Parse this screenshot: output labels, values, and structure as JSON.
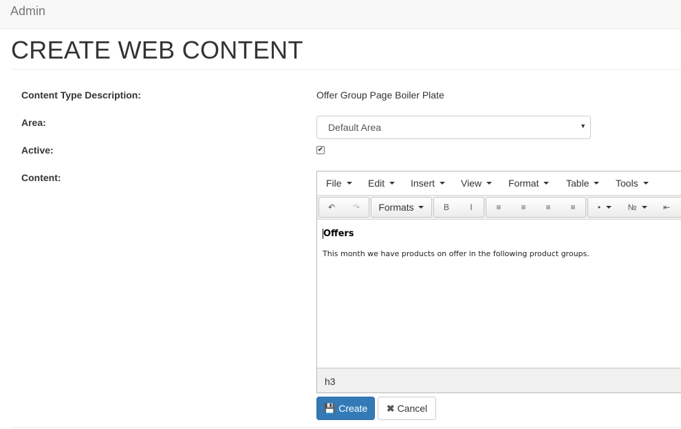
{
  "app": {
    "brand": "Admin"
  },
  "page": {
    "title": "CREATE WEB CONTENT"
  },
  "form": {
    "content_type_label": "Content Type Description:",
    "content_type_value": "Offer Group Page Boiler Plate",
    "area_label": "Area:",
    "area_selected": "Default Area",
    "active_label": "Active:",
    "active_checked": true,
    "content_label": "Content:"
  },
  "editor": {
    "menu": [
      "File",
      "Edit",
      "Insert",
      "View",
      "Format",
      "Table",
      "Tools"
    ],
    "formats_label": "Formats",
    "toolbar_icons": [
      "undo-icon",
      "redo-icon",
      "align-left-icon",
      "align-center-icon",
      "align-right-icon",
      "align-justify-icon",
      "bullet-list-icon",
      "numbered-list-icon",
      "outdent-icon"
    ],
    "document": {
      "heading": "Offers",
      "paragraph": "This month we have products on offer in the following product groups."
    },
    "statusbar_path": "h3"
  },
  "actions": {
    "create_label": "Create",
    "cancel_label": "Cancel"
  },
  "colors": {
    "primary": "#337ab7",
    "navbar_bg": "#f8f8f8"
  }
}
